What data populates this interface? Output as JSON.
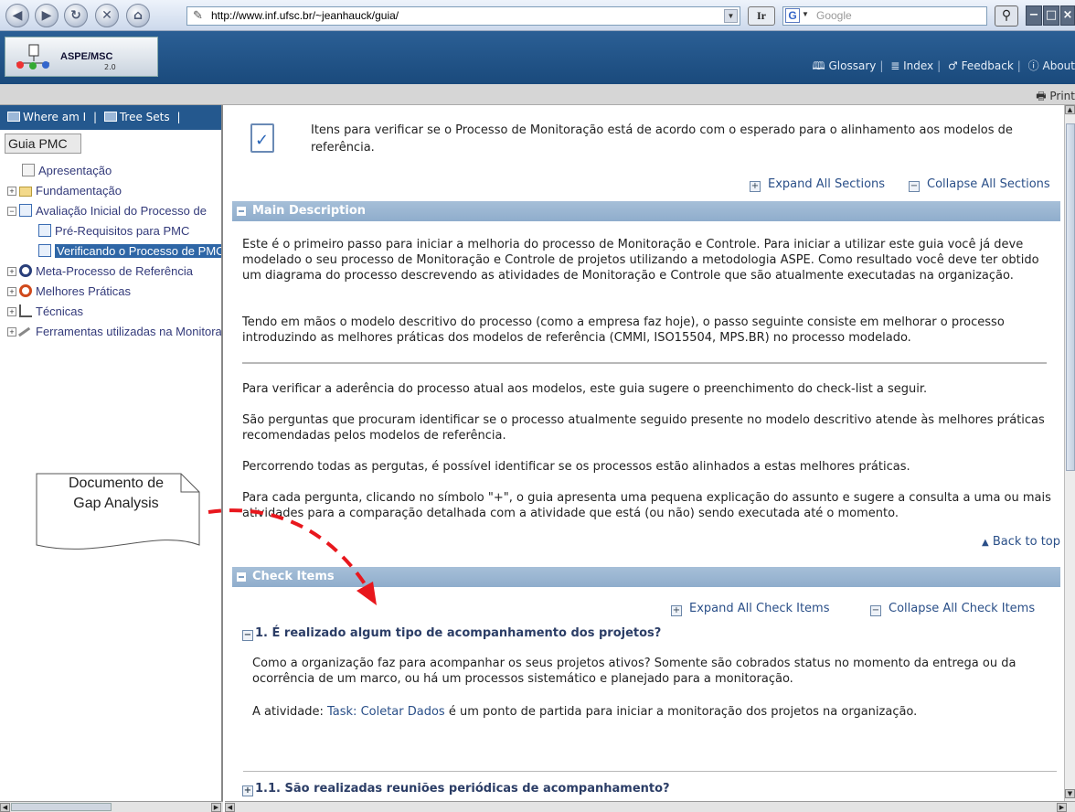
{
  "browser": {
    "url": "http://www.inf.ufsc.br/~jeanhauck/guia/",
    "ir_button": "Ir",
    "search_placeholder": "Google"
  },
  "header": {
    "logo_text": "ASPE/MSC",
    "logo_version": "2.0",
    "links": [
      "Glossary",
      "Index",
      "Feedback",
      "About"
    ],
    "print_label": "Print"
  },
  "leftnav": {
    "tabs": [
      "Where am I",
      "Tree Sets"
    ],
    "guide_label": "Guia PMC",
    "tree": [
      {
        "label": "Apresentação",
        "icon": "page-icon",
        "expander": "",
        "indent": 0
      },
      {
        "label": "Fundamentação",
        "icon": "folder-icon",
        "expander": "+",
        "indent": 0
      },
      {
        "label": "Avaliação Inicial do Processo de",
        "icon": "checklist-icon",
        "expander": "−",
        "indent": 0
      },
      {
        "label": "Pré-Requisitos para PMC",
        "icon": "checklist-icon",
        "expander": "",
        "indent": 1
      },
      {
        "label": "Verificando o Processo de PMC",
        "icon": "checklist-icon",
        "expander": "",
        "indent": 1,
        "selected": true
      },
      {
        "label": "Meta-Processo de Referência",
        "icon": "cycle-icon",
        "expander": "+",
        "indent": 0
      },
      {
        "label": "Melhores Práticas",
        "icon": "lifebuoy-icon",
        "expander": "+",
        "indent": 0
      },
      {
        "label": "Técnicas",
        "icon": "chart-icon",
        "expander": "+",
        "indent": 0
      },
      {
        "label": "Ferramentas utilizadas na Monitoração",
        "icon": "tool-icon",
        "expander": "+",
        "indent": 0
      }
    ]
  },
  "main": {
    "intro": "Itens para verificar se o Processo de Monitoração está de acordo com o esperado para o alinhamento aos modelos de referência.",
    "expand_all_sections": "Expand All Sections",
    "collapse_all_sections": "Collapse All Sections",
    "main_description_title": "Main Description",
    "paragraphs": [
      "Este é o primeiro passo para iniciar a melhoria do processo de Monitoração e Controle. Para iniciar a utilizar este guia você já deve modelado o seu processo de Monitoração e Controle de projetos utilizando a metodologia ASPE. Como resultado você deve ter obtido um diagrama do processo descrevendo as atividades de Monitoração e Controle que são atualmente executadas na organização.",
      "Tendo em mãos o modelo descritivo do processo (como a empresa faz hoje), o passo seguinte consiste em melhorar o processo introduzindo as melhores práticas dos modelos de referência (CMMI, ISO15504, MPS.BR) no processo modelado.",
      "Para verificar a aderência do processo atual aos modelos, este guia sugere o preenchimento do check-list a seguir.",
      "São perguntas que procuram identificar se o processo atualmente seguido presente no modelo descritivo atende às melhores práticas recomendadas pelos modelos de referência.",
      "Percorrendo todas as pergutas, é possível identificar se os processos estão alinhados a estas melhores práticas.",
      "Para cada pergunta, clicando no símbolo \"+\", o guia apresenta uma pequena explicação do assunto e sugere a consulta a uma ou mais atividades para a comparação detalhada com a atividade que está (ou não) sendo executada até o momento."
    ],
    "back_to_top": "Back to top",
    "check_items_title": "Check Items",
    "expand_all_items": "Expand All Check Items",
    "collapse_all_items": "Collapse All Check Items",
    "q1_title": "1. É realizado algum tipo de acompanhamento dos projetos?",
    "q1_body": "Como a organização faz para acompanhar os seus projetos ativos? Somente são cobrados status no momento da entrega ou da ocorrência de um marco, ou há um processos sistemático e planejado para a monitoração.",
    "q1_activity_prefix": "A atividade:",
    "q1_task_link": "Task: Coletar Dados",
    "q1_activity_suffix": "é um ponto de partida para iniciar a monitoração dos projetos na organização.",
    "q11_title": "1.1. São realizadas reuniões periódicas de acompanhamento?"
  },
  "annotation": {
    "callout_line1": "Documento de",
    "callout_line2": "Gap Analysis",
    "arrow_color": "#e8171d"
  }
}
